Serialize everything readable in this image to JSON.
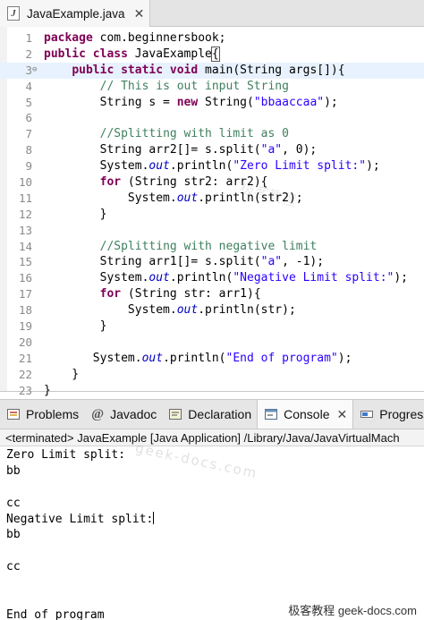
{
  "editor": {
    "tab": {
      "label": "JavaExample.java",
      "icon": "java-file-icon"
    },
    "current_line": 3,
    "lines": [
      {
        "n": "1",
        "code": "package com.beginnersbook;"
      },
      {
        "n": "2",
        "code": "public class JavaExample{"
      },
      {
        "n": "3",
        "code": "    public static void main(String args[]){"
      },
      {
        "n": "4",
        "code": "        // This is out input String"
      },
      {
        "n": "5",
        "code": "        String s = new String(\"bbaaccaa\");"
      },
      {
        "n": "6",
        "code": ""
      },
      {
        "n": "7",
        "code": "        //Splitting with limit as 0"
      },
      {
        "n": "8",
        "code": "        String arr2[]= s.split(\"a\", 0);"
      },
      {
        "n": "9",
        "code": "        System.out.println(\"Zero Limit split:\");"
      },
      {
        "n": "10",
        "code": "        for (String str2: arr2){"
      },
      {
        "n": "11",
        "code": "            System.out.println(str2);"
      },
      {
        "n": "12",
        "code": "        }"
      },
      {
        "n": "13",
        "code": ""
      },
      {
        "n": "14",
        "code": "        //Splitting with negative limit"
      },
      {
        "n": "15",
        "code": "        String arr1[]= s.split(\"a\", -1);"
      },
      {
        "n": "16",
        "code": "        System.out.println(\"Negative Limit split:\");"
      },
      {
        "n": "17",
        "code": "        for (String str: arr1){"
      },
      {
        "n": "18",
        "code": "            System.out.println(str);"
      },
      {
        "n": "19",
        "code": "        }"
      },
      {
        "n": "20",
        "code": ""
      },
      {
        "n": "21",
        "code": "       System.out.println(\"End of program\");"
      },
      {
        "n": "22",
        "code": "    }"
      },
      {
        "n": "23",
        "code": "}"
      }
    ]
  },
  "views": {
    "tabs": [
      {
        "label": "Problems",
        "icon": "problems-icon",
        "active": false
      },
      {
        "label": "Javadoc",
        "icon": "javadoc-icon",
        "active": false
      },
      {
        "label": "Declaration",
        "icon": "declaration-icon",
        "active": false
      },
      {
        "label": "Console",
        "icon": "console-icon",
        "active": true
      },
      {
        "label": "Progress",
        "icon": "progress-icon",
        "active": false
      }
    ]
  },
  "console": {
    "header": "<terminated> JavaExample [Java Application] /Library/Java/JavaVirtualMach",
    "output": [
      "Zero Limit split:",
      "bb",
      "",
      "cc",
      "Negative Limit split:",
      "bb",
      "",
      "cc",
      "",
      "",
      "End of program"
    ]
  },
  "watermarks": {
    "code": "极客教程",
    "console": "geek-docs.com",
    "corner": "极客教程 geek-docs.com"
  },
  "colors": {
    "keyword": "#7f0055",
    "string": "#2a00ff",
    "comment": "#3f7f5f",
    "field": "#0000c0",
    "current_line": "#e8f2fe"
  }
}
